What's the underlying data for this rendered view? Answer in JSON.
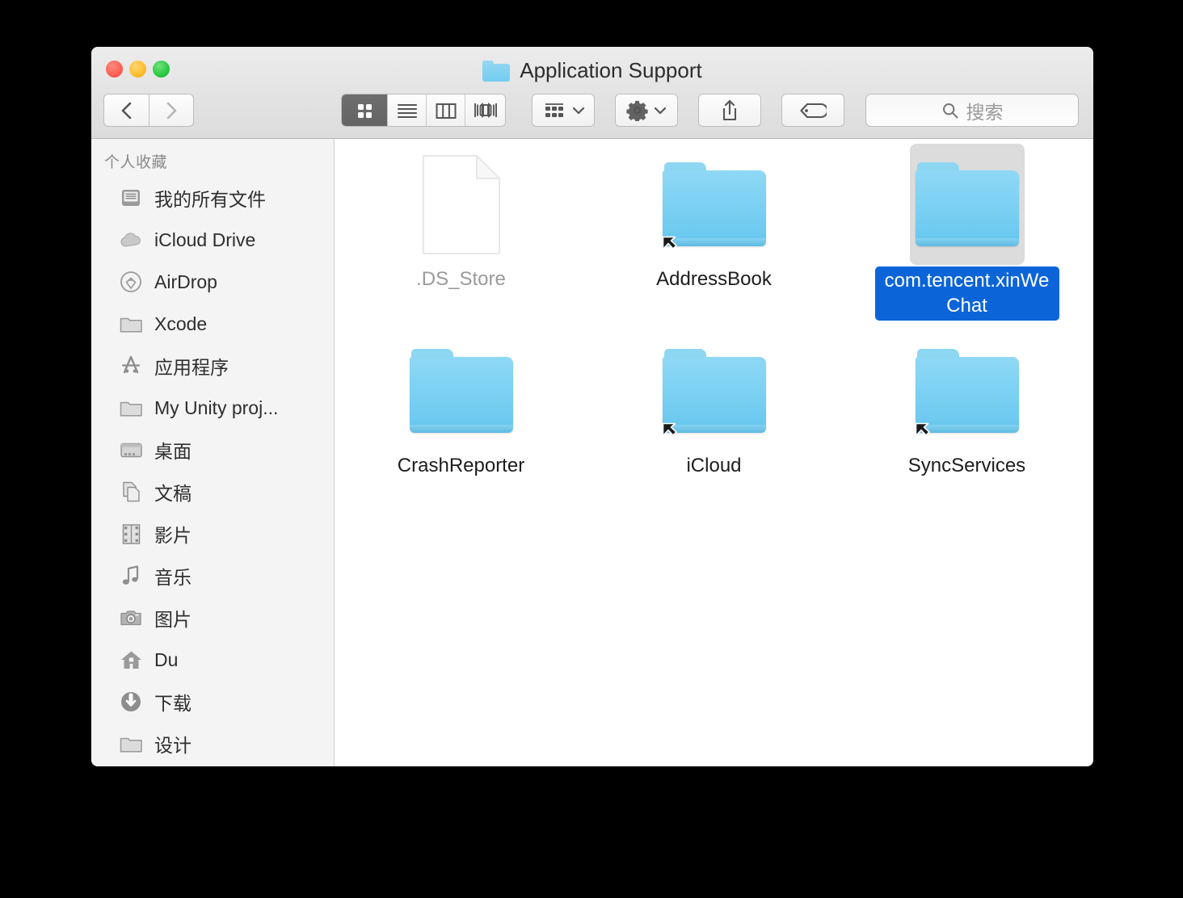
{
  "window": {
    "title": "Application Support",
    "title_icon": "folder-icon",
    "traffic_lights": [
      {
        "name": "close-button",
        "color": "#FF5F52"
      },
      {
        "name": "minimize-button",
        "color": "#FFBD2E"
      },
      {
        "name": "maximize-button",
        "color": "#28C93F"
      }
    ]
  },
  "toolbar": {
    "back_label": "Back",
    "forward_label": "Forward",
    "view_modes": [
      {
        "id": "icon",
        "icon": "grid-view-icon",
        "label": "Icon View",
        "active": true
      },
      {
        "id": "list",
        "icon": "list-view-icon",
        "label": "List View",
        "active": false
      },
      {
        "id": "column",
        "icon": "column-view-icon",
        "label": "Column View",
        "active": false
      },
      {
        "id": "coverflow",
        "icon": "coverflow-view-icon",
        "label": "Cover Flow View",
        "active": false
      }
    ],
    "arrange_label": "Arrange",
    "arrange_icon": "arrange-icon",
    "action_label": "Action",
    "action_icon": "gear-icon",
    "share_label": "Share",
    "share_icon": "share-icon",
    "tags_label": "Tags",
    "tags_icon": "tag-icon"
  },
  "search": {
    "icon": "search-icon",
    "placeholder": "搜索",
    "value": ""
  },
  "sidebar": {
    "header": "个人收藏",
    "items": [
      {
        "label": "我的所有文件",
        "icon": "all-my-files-icon"
      },
      {
        "label": "iCloud Drive",
        "icon": "icloud-drive-icon"
      },
      {
        "label": "AirDrop",
        "icon": "airdrop-icon"
      },
      {
        "label": "Xcode",
        "icon": "folder-icon"
      },
      {
        "label": "应用程序",
        "icon": "applications-icon"
      },
      {
        "label": "My Unity proj...",
        "icon": "folder-icon"
      },
      {
        "label": "桌面",
        "icon": "desktop-icon"
      },
      {
        "label": "文稿",
        "icon": "documents-icon"
      },
      {
        "label": "影片",
        "icon": "movies-icon"
      },
      {
        "label": "音乐",
        "icon": "music-icon"
      },
      {
        "label": "图片",
        "icon": "pictures-icon"
      },
      {
        "label": "Du",
        "icon": "home-icon"
      },
      {
        "label": "下载",
        "icon": "downloads-icon"
      },
      {
        "label": "设计",
        "icon": "folder-icon"
      }
    ]
  },
  "main": {
    "items": [
      {
        "label": ".DS_Store",
        "type": "file",
        "icon": "document-icon",
        "dimmed": true,
        "alias": false,
        "selected": false
      },
      {
        "label": "AddressBook",
        "type": "folder",
        "icon": "folder-icon",
        "dimmed": false,
        "alias": true,
        "selected": false
      },
      {
        "label": "com.tencent.xinWeChat",
        "type": "folder",
        "icon": "folder-icon",
        "dimmed": false,
        "alias": false,
        "selected": true
      },
      {
        "label": "CrashReporter",
        "type": "folder",
        "icon": "folder-icon",
        "dimmed": false,
        "alias": false,
        "selected": false
      },
      {
        "label": "iCloud",
        "type": "folder",
        "icon": "folder-icon",
        "dimmed": false,
        "alias": true,
        "selected": false
      },
      {
        "label": "SyncServices",
        "type": "folder",
        "icon": "folder-icon",
        "dimmed": false,
        "alias": true,
        "selected": false
      }
    ]
  },
  "colors": {
    "selection_blue": "#0B65D8",
    "selection_gray": "#DCDCDC",
    "folder_blue": "#7ED2F3",
    "sidebar_bg": "#F4F4F4",
    "toolbar_bg": "#E6E6E6",
    "desktop_bg": "#000000"
  }
}
